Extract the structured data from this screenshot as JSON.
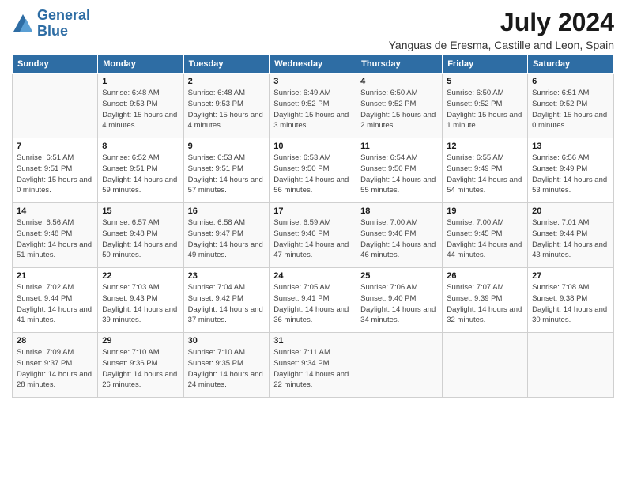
{
  "logo": {
    "line1": "General",
    "line2": "Blue"
  },
  "title": "July 2024",
  "subtitle": "Yanguas de Eresma, Castille and Leon, Spain",
  "days_of_week": [
    "Sunday",
    "Monday",
    "Tuesday",
    "Wednesday",
    "Thursday",
    "Friday",
    "Saturday"
  ],
  "weeks": [
    [
      {
        "day": "",
        "sunrise": "",
        "sunset": "",
        "daylight": ""
      },
      {
        "day": "1",
        "sunrise": "Sunrise: 6:48 AM",
        "sunset": "Sunset: 9:53 PM",
        "daylight": "Daylight: 15 hours and 4 minutes."
      },
      {
        "day": "2",
        "sunrise": "Sunrise: 6:48 AM",
        "sunset": "Sunset: 9:53 PM",
        "daylight": "Daylight: 15 hours and 4 minutes."
      },
      {
        "day": "3",
        "sunrise": "Sunrise: 6:49 AM",
        "sunset": "Sunset: 9:52 PM",
        "daylight": "Daylight: 15 hours and 3 minutes."
      },
      {
        "day": "4",
        "sunrise": "Sunrise: 6:50 AM",
        "sunset": "Sunset: 9:52 PM",
        "daylight": "Daylight: 15 hours and 2 minutes."
      },
      {
        "day": "5",
        "sunrise": "Sunrise: 6:50 AM",
        "sunset": "Sunset: 9:52 PM",
        "daylight": "Daylight: 15 hours and 1 minute."
      },
      {
        "day": "6",
        "sunrise": "Sunrise: 6:51 AM",
        "sunset": "Sunset: 9:52 PM",
        "daylight": "Daylight: 15 hours and 0 minutes."
      }
    ],
    [
      {
        "day": "7",
        "sunrise": "Sunrise: 6:51 AM",
        "sunset": "Sunset: 9:51 PM",
        "daylight": "Daylight: 15 hours and 0 minutes."
      },
      {
        "day": "8",
        "sunrise": "Sunrise: 6:52 AM",
        "sunset": "Sunset: 9:51 PM",
        "daylight": "Daylight: 14 hours and 59 minutes."
      },
      {
        "day": "9",
        "sunrise": "Sunrise: 6:53 AM",
        "sunset": "Sunset: 9:51 PM",
        "daylight": "Daylight: 14 hours and 57 minutes."
      },
      {
        "day": "10",
        "sunrise": "Sunrise: 6:53 AM",
        "sunset": "Sunset: 9:50 PM",
        "daylight": "Daylight: 14 hours and 56 minutes."
      },
      {
        "day": "11",
        "sunrise": "Sunrise: 6:54 AM",
        "sunset": "Sunset: 9:50 PM",
        "daylight": "Daylight: 14 hours and 55 minutes."
      },
      {
        "day": "12",
        "sunrise": "Sunrise: 6:55 AM",
        "sunset": "Sunset: 9:49 PM",
        "daylight": "Daylight: 14 hours and 54 minutes."
      },
      {
        "day": "13",
        "sunrise": "Sunrise: 6:56 AM",
        "sunset": "Sunset: 9:49 PM",
        "daylight": "Daylight: 14 hours and 53 minutes."
      }
    ],
    [
      {
        "day": "14",
        "sunrise": "Sunrise: 6:56 AM",
        "sunset": "Sunset: 9:48 PM",
        "daylight": "Daylight: 14 hours and 51 minutes."
      },
      {
        "day": "15",
        "sunrise": "Sunrise: 6:57 AM",
        "sunset": "Sunset: 9:48 PM",
        "daylight": "Daylight: 14 hours and 50 minutes."
      },
      {
        "day": "16",
        "sunrise": "Sunrise: 6:58 AM",
        "sunset": "Sunset: 9:47 PM",
        "daylight": "Daylight: 14 hours and 49 minutes."
      },
      {
        "day": "17",
        "sunrise": "Sunrise: 6:59 AM",
        "sunset": "Sunset: 9:46 PM",
        "daylight": "Daylight: 14 hours and 47 minutes."
      },
      {
        "day": "18",
        "sunrise": "Sunrise: 7:00 AM",
        "sunset": "Sunset: 9:46 PM",
        "daylight": "Daylight: 14 hours and 46 minutes."
      },
      {
        "day": "19",
        "sunrise": "Sunrise: 7:00 AM",
        "sunset": "Sunset: 9:45 PM",
        "daylight": "Daylight: 14 hours and 44 minutes."
      },
      {
        "day": "20",
        "sunrise": "Sunrise: 7:01 AM",
        "sunset": "Sunset: 9:44 PM",
        "daylight": "Daylight: 14 hours and 43 minutes."
      }
    ],
    [
      {
        "day": "21",
        "sunrise": "Sunrise: 7:02 AM",
        "sunset": "Sunset: 9:44 PM",
        "daylight": "Daylight: 14 hours and 41 minutes."
      },
      {
        "day": "22",
        "sunrise": "Sunrise: 7:03 AM",
        "sunset": "Sunset: 9:43 PM",
        "daylight": "Daylight: 14 hours and 39 minutes."
      },
      {
        "day": "23",
        "sunrise": "Sunrise: 7:04 AM",
        "sunset": "Sunset: 9:42 PM",
        "daylight": "Daylight: 14 hours and 37 minutes."
      },
      {
        "day": "24",
        "sunrise": "Sunrise: 7:05 AM",
        "sunset": "Sunset: 9:41 PM",
        "daylight": "Daylight: 14 hours and 36 minutes."
      },
      {
        "day": "25",
        "sunrise": "Sunrise: 7:06 AM",
        "sunset": "Sunset: 9:40 PM",
        "daylight": "Daylight: 14 hours and 34 minutes."
      },
      {
        "day": "26",
        "sunrise": "Sunrise: 7:07 AM",
        "sunset": "Sunset: 9:39 PM",
        "daylight": "Daylight: 14 hours and 32 minutes."
      },
      {
        "day": "27",
        "sunrise": "Sunrise: 7:08 AM",
        "sunset": "Sunset: 9:38 PM",
        "daylight": "Daylight: 14 hours and 30 minutes."
      }
    ],
    [
      {
        "day": "28",
        "sunrise": "Sunrise: 7:09 AM",
        "sunset": "Sunset: 9:37 PM",
        "daylight": "Daylight: 14 hours and 28 minutes."
      },
      {
        "day": "29",
        "sunrise": "Sunrise: 7:10 AM",
        "sunset": "Sunset: 9:36 PM",
        "daylight": "Daylight: 14 hours and 26 minutes."
      },
      {
        "day": "30",
        "sunrise": "Sunrise: 7:10 AM",
        "sunset": "Sunset: 9:35 PM",
        "daylight": "Daylight: 14 hours and 24 minutes."
      },
      {
        "day": "31",
        "sunrise": "Sunrise: 7:11 AM",
        "sunset": "Sunset: 9:34 PM",
        "daylight": "Daylight: 14 hours and 22 minutes."
      },
      {
        "day": "",
        "sunrise": "",
        "sunset": "",
        "daylight": ""
      },
      {
        "day": "",
        "sunrise": "",
        "sunset": "",
        "daylight": ""
      },
      {
        "day": "",
        "sunrise": "",
        "sunset": "",
        "daylight": ""
      }
    ]
  ]
}
